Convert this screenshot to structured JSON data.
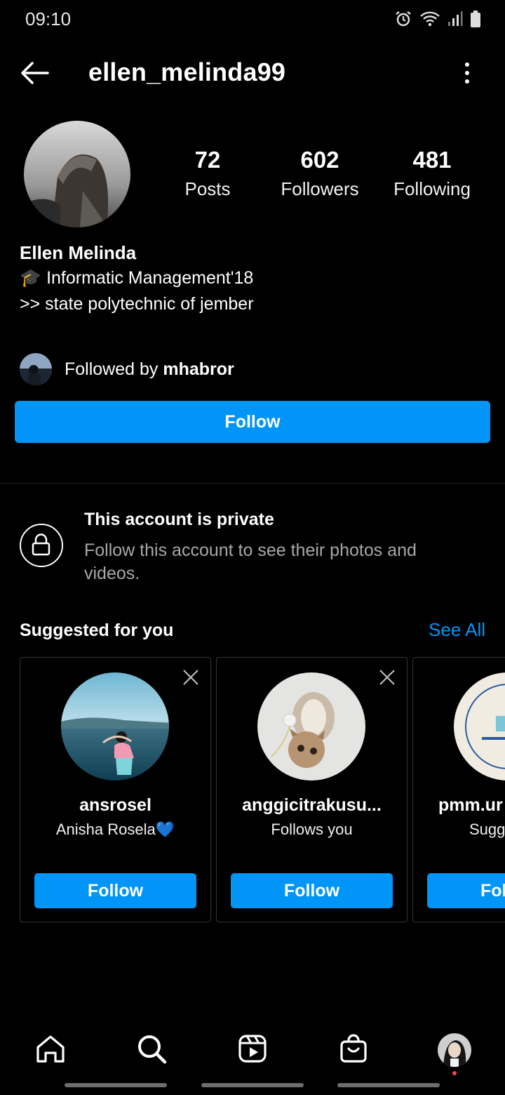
{
  "status": {
    "time": "09:10",
    "icons": [
      "alarm-icon",
      "wifi-icon",
      "signal-icon",
      "battery-icon"
    ]
  },
  "header": {
    "username": "ellen_melinda99",
    "back_icon": "back-arrow-icon",
    "more_icon": "more-options-icon"
  },
  "profile": {
    "stats": [
      {
        "value": "72",
        "label": "Posts"
      },
      {
        "value": "602",
        "label": "Followers"
      },
      {
        "value": "481",
        "label": "Following"
      }
    ],
    "full_name": "Ellen Melinda",
    "bio_lines": [
      "🎓 Informatic Management'18",
      ">> state polytechnic of jember"
    ],
    "followed_by_prefix": "Followed by ",
    "followed_by_user": "mhabror",
    "follow_label": "Follow"
  },
  "private": {
    "title": "This account is private",
    "description": "Follow this account to see their photos and videos."
  },
  "suggested": {
    "title": "Suggested for you",
    "see_all": "See All",
    "cards": [
      {
        "username": "ansrosel",
        "subtitle": "Anisha Rosela💙",
        "follow_label": "Follow"
      },
      {
        "username": "anggicitrakusu...",
        "subtitle": "Follows you",
        "follow_label": "Follow"
      },
      {
        "username": "pmm.ur",
        "subtitle": "Sugg",
        "follow_label": "Fol"
      }
    ]
  },
  "colors": {
    "background": "#000000",
    "accent": "#0095f6",
    "secondary_text": "#a8a8a8",
    "border": "#363636",
    "notification_dot": "#ed4956"
  },
  "nav": {
    "items": [
      "home-icon",
      "search-icon",
      "reels-icon",
      "shop-icon",
      "profile-avatar"
    ]
  }
}
